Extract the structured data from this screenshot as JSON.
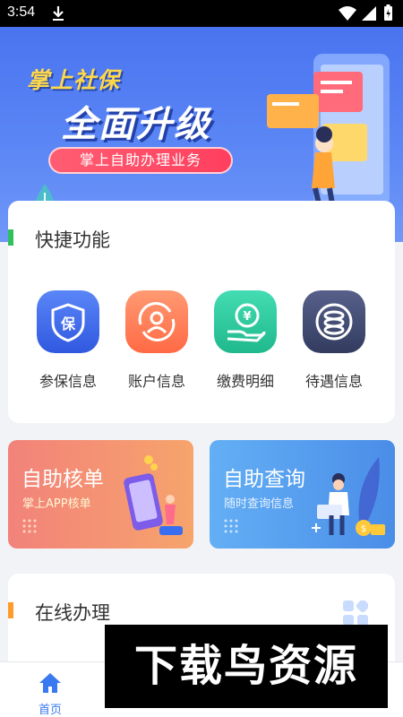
{
  "status_bar": {
    "time": "3:54"
  },
  "banner": {
    "title": "掌上社保",
    "headline": "全面升级",
    "pill": "掌上自助办理业务"
  },
  "quick": {
    "title": "快捷功能",
    "items": [
      {
        "label": "参保信息",
        "icon": "shield-bao-icon",
        "color": "#3f6ef0"
      },
      {
        "label": "账户信息",
        "icon": "account-refresh-icon",
        "color": "#ff7650"
      },
      {
        "label": "缴费明细",
        "icon": "yen-payment-icon",
        "color": "#27c8a0"
      },
      {
        "label": "待遇信息",
        "icon": "coin-stack-icon",
        "color": "#3e4a6e"
      }
    ]
  },
  "promos": [
    {
      "title": "自助核单",
      "subtitle": "掌上APP核单",
      "color": "#f5896a"
    },
    {
      "title": "自助查询",
      "subtitle": "随时查询信息",
      "color": "#5aa4f0"
    }
  ],
  "online": {
    "title": "在线办理"
  },
  "bottom_nav": {
    "home_label": "首页"
  },
  "watermark": {
    "text": "下载鸟资源"
  },
  "colors": {
    "accent": "#3a7af0",
    "green_bar": "#2fbf5c",
    "orange_bar": "#ff9a2b"
  }
}
